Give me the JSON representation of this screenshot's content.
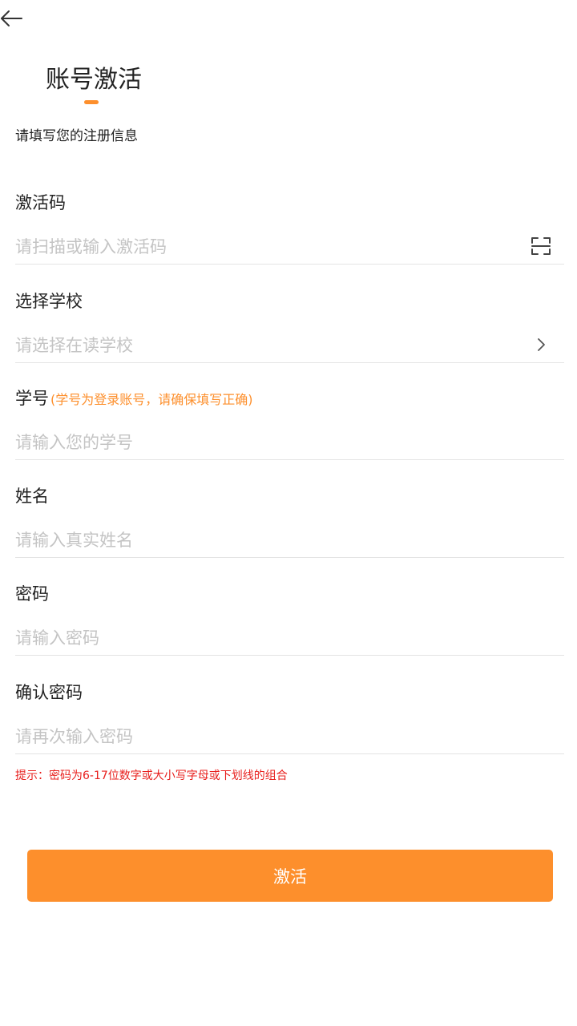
{
  "colors": {
    "accent": "#FD8F2C",
    "tip_red": "#E8201E",
    "placeholder": "#C4C4C4",
    "divider": "#E4E4E4",
    "text": "#222222"
  },
  "header": {
    "back_icon": "arrow-left-icon",
    "title": "账号激活",
    "subtitle": "请填写您的注册信息"
  },
  "form": {
    "activation_code": {
      "label": "激活码",
      "value": "",
      "placeholder": "请扫描或输入激活码",
      "icon": "scan-icon"
    },
    "school": {
      "label": "选择学校",
      "value": "",
      "placeholder": "请选择在读学校",
      "icon": "chevron-right-icon"
    },
    "student_id": {
      "label": "学号",
      "hint": "(学号为登录账号，请确保填写正确)",
      "value": "",
      "placeholder": "请输入您的学号"
    },
    "name": {
      "label": "姓名",
      "value": "",
      "placeholder": "请输入真实姓名"
    },
    "password": {
      "label": "密码",
      "value": "",
      "placeholder": "请输入密码"
    },
    "confirm_password": {
      "label": "确认密码",
      "value": "",
      "placeholder": "请再次输入密码"
    },
    "password_tip": "提示：密码为6-17位数字或大小写字母或下划线的组合",
    "submit_label": "激活"
  }
}
